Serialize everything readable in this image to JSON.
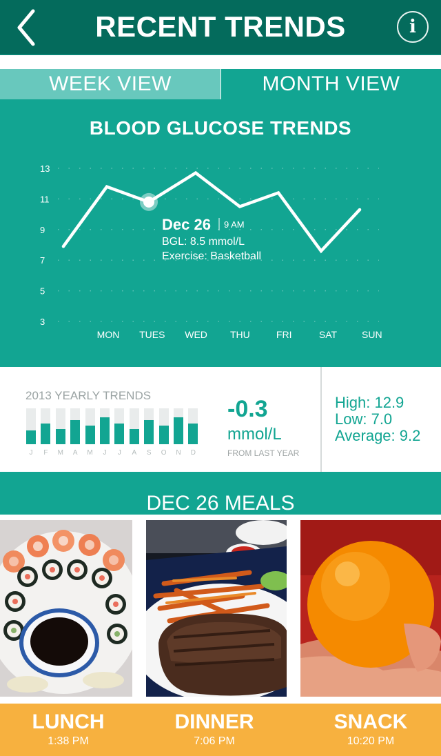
{
  "header": {
    "title": "RECENT TRENDS",
    "back_icon": "chevron-left-icon",
    "info_icon": "info-icon",
    "info_glyph": "i"
  },
  "view_tabs": [
    {
      "label": "WEEK VIEW",
      "selected": true
    },
    {
      "label": "MONTH VIEW",
      "selected": false
    }
  ],
  "chart_data": {
    "type": "line",
    "title": "BLOOD GLUCOSE TRENDS",
    "categories": [
      "MON",
      "TUES",
      "WED",
      "THU",
      "FRI",
      "SAT",
      "SUN"
    ],
    "x": [
      0,
      1,
      2,
      3,
      4,
      5,
      6
    ],
    "series": [
      {
        "values": [
          7.9,
          11.8,
          10.8,
          12.7,
          10.5,
          11.4,
          7.6,
          10.3
        ]
      }
    ],
    "yticks": [
      3,
      5,
      7,
      9,
      11,
      13
    ],
    "ylim": [
      3,
      13
    ],
    "grid": "dotted",
    "color": "#ffffff",
    "highlight": {
      "index": 2,
      "date": "Dec 26",
      "time": "9 AM",
      "bgl": "BGL: 8.5 mmol/L",
      "exercise": "Exercise: Basketball"
    }
  },
  "yearly": {
    "title": "2013 YEARLY TRENDS",
    "months": [
      "J",
      "F",
      "M",
      "A",
      "M",
      "J",
      "J",
      "A",
      "S",
      "O",
      "N",
      "D"
    ],
    "values": [
      0.38,
      0.58,
      0.42,
      0.68,
      0.52,
      0.75,
      0.58,
      0.42,
      0.68,
      0.52,
      0.75,
      0.58
    ],
    "delta": "-0.3",
    "unit": "mmol/L",
    "caption": "FROM LAST YEAR",
    "high": "High: 12.9",
    "low": "Low: 7.0",
    "average": "Average: 9.2",
    "accent": "#12a592"
  },
  "meals": {
    "title": "DEC 26 MEALS",
    "items": [
      {
        "name": "LUNCH",
        "time": "1:38 PM",
        "photo": "sushi-photo"
      },
      {
        "name": "DINNER",
        "time": "7:06 PM",
        "photo": "steak-fries-photo"
      },
      {
        "name": "SNACK",
        "time": "10:20 PM",
        "photo": "orange-photo"
      }
    ]
  },
  "colors": {
    "header": "#046b5c",
    "teal": "#12a592",
    "tab_selected": "#68c8bd",
    "meal_bar": "#f7b13f"
  }
}
